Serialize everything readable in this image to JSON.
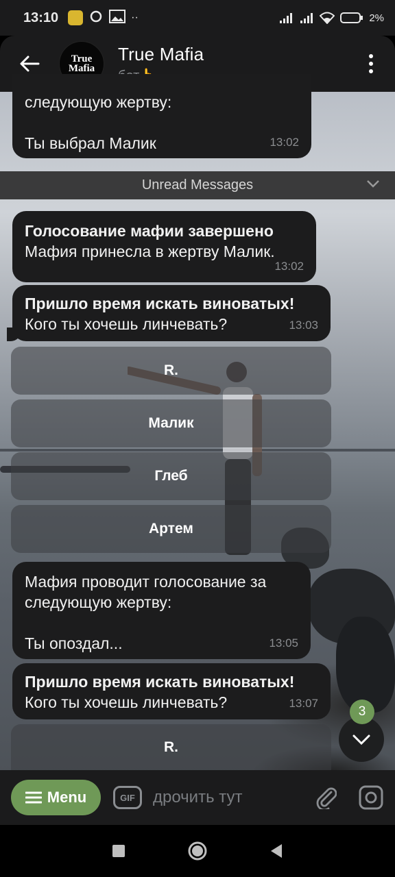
{
  "status_bar": {
    "time": "13:10",
    "extra": "··",
    "battery": "2%"
  },
  "header": {
    "title": "True Mafia",
    "subtitle": "бот👆",
    "avatar_line1": "True",
    "avatar_line2": "Mafia"
  },
  "messages": [
    {
      "partial_text": "следующую жертву:",
      "text": "Ты выбрал Малик",
      "time": "13:02"
    },
    {
      "bold": "Голосование мафии завершено",
      "text": "Мафия принесла в жертву Малик.",
      "time": "13:02"
    },
    {
      "bold": "Пришло время искать виноватых!",
      "text": "Кого ты хочешь линчевать?",
      "time": "13:03",
      "buttons": [
        "R.",
        "Малик",
        "Глеб",
        "Артем"
      ]
    },
    {
      "line1": "Мафия проводит голосование за",
      "line2": "следующую жертву:",
      "text": "Ты опоздал...",
      "time": "13:05"
    },
    {
      "bold": "Пришло время искать виноватых!",
      "text": "Кого ты хочешь линчевать?",
      "time": "13:07",
      "buttons": [
        "R."
      ]
    }
  ],
  "unread_label": "Unread Messages",
  "scroll_badge": "3",
  "input": {
    "menu_label": "Menu",
    "gif_label": "GIF",
    "placeholder": "дрочить тут"
  },
  "colors": {
    "accent": "#6f9957",
    "bubble": "#1c1c1d",
    "bar": "#1b1b1c"
  }
}
